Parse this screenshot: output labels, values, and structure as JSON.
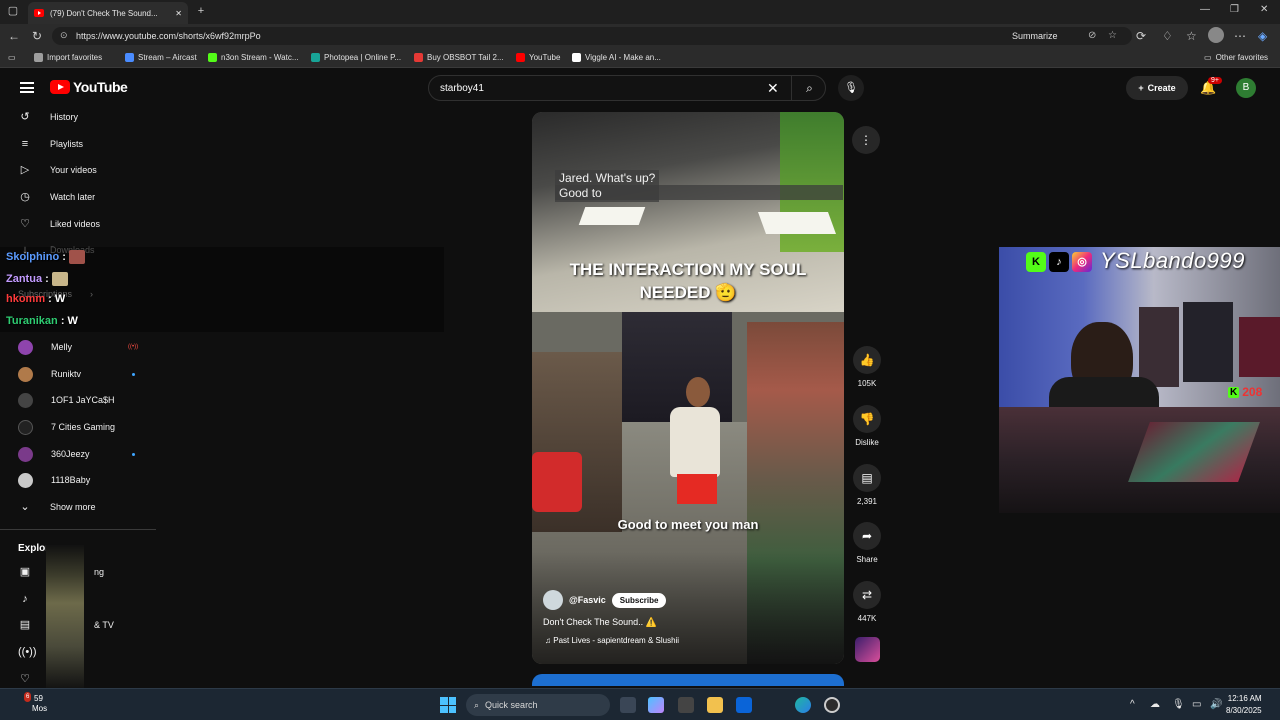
{
  "browser": {
    "tab_title": "(79) Don't Check The Sound...",
    "url": "https://www.youtube.com/shorts/x6wf92mrpPo",
    "summarize_label": "Summarize",
    "bookmarks": [
      {
        "label": "Import favorites",
        "color": "#9e9e9e"
      },
      {
        "label": "Stream – Aircast",
        "color": "#4a8cff"
      },
      {
        "label": "n3on Stream - Watc...",
        "color": "#53fc18"
      },
      {
        "label": "Photopea | Online P...",
        "color": "#18a497"
      },
      {
        "label": "Buy OBSBOT Tail 2...",
        "color": "#e53935"
      },
      {
        "label": "YouTube",
        "color": "#ff0000"
      },
      {
        "label": "Viggle AI - Make an...",
        "color": "#ffffff"
      }
    ],
    "other_favorites": "Other favorites"
  },
  "youtube": {
    "logo_text": "YouTube",
    "search_query": "starboy41",
    "create_label": "Create",
    "notifications_badge": "9+",
    "avatar_letter": "B"
  },
  "sidebar": {
    "items": [
      {
        "label": "History",
        "icon": "history-icon",
        "glyph": "↺"
      },
      {
        "label": "Playlists",
        "icon": "playlists-icon",
        "glyph": "≡"
      },
      {
        "label": "Your videos",
        "icon": "your-videos-icon",
        "glyph": "▷"
      },
      {
        "label": "Watch later",
        "icon": "clock-icon",
        "glyph": "◷"
      },
      {
        "label": "Liked videos",
        "icon": "thumbs-up-icon",
        "glyph": "👍"
      }
    ],
    "downloads_label": "Downloads",
    "subscriptions_label": "Subscriptions",
    "subscriptions": [
      {
        "label": "Melly",
        "color": "#8e44ad",
        "status": "live"
      },
      {
        "label": "Runiktv",
        "color": "#b07a4a",
        "status": "dot"
      },
      {
        "label": "1OF1 JaYCa$H",
        "color": "#444444",
        "status": ""
      },
      {
        "label": "7 Cities Gaming",
        "color": "#222222",
        "status": ""
      },
      {
        "label": "360Jeezy",
        "color": "#7a3a8a",
        "status": "dot"
      },
      {
        "label": "1118Baby",
        "color": "#c9c9c9",
        "status": ""
      }
    ],
    "show_more_label": "Show more",
    "explore_label": "Explore",
    "explore_partial": [
      "ng",
      "& TV"
    ]
  },
  "chat": [
    {
      "user": "Skolphino",
      "color": "#5b9bff",
      "msg": ""
    },
    {
      "user": "Zantua",
      "color": "#c39bff",
      "msg": ""
    },
    {
      "user": "hkomm",
      "color": "#ff3b3b",
      "msg": "W"
    },
    {
      "user": "Turanikan",
      "color": "#2ecc71",
      "msg": "W"
    }
  ],
  "short": {
    "caption_line1": "Jared. What's up?",
    "caption_line2": "Good to",
    "title_overlay": "THE INTERACTION MY SOUL NEEDED 🫡",
    "subtitle": "Good to meet you man",
    "channel": "@Fasvic",
    "subscribe_label": "Subscribe",
    "video_title": "Don't Check The Sound.. ⚠️",
    "music": "Past Lives - sapientdream & Slushii",
    "actions": {
      "likes": "105K",
      "dislike_label": "Dislike",
      "comments": "2,391",
      "share_label": "Share",
      "remix": "447K"
    }
  },
  "webcam": {
    "handle": "YSLbando999",
    "kick_count": "208"
  },
  "taskbar": {
    "weather_temp": "59",
    "weather_desc": "Mos",
    "weather_badge": "6",
    "search_placeholder": "Quick search",
    "time": "12:16 AM",
    "date": "8/30/2025"
  }
}
